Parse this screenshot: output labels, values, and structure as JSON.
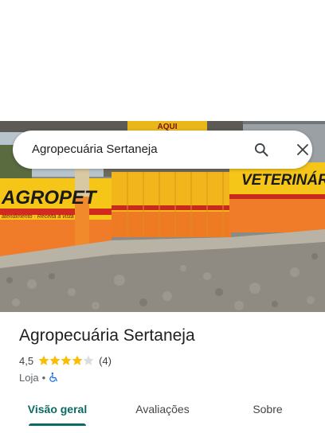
{
  "search": {
    "query": "Agropecuária Sertaneja"
  },
  "photo": {
    "signs": {
      "top": "AQUI",
      "left": "AGROPET",
      "left_sub": "atendimento · Receita à vista",
      "right": "VETERINÁRIA"
    }
  },
  "place": {
    "name": "Agropecuária Sertaneja",
    "rating": "4,5",
    "rating_fraction": 0.9,
    "review_count": "(4)",
    "category": "Loja",
    "separator": "•"
  },
  "tabs": [
    {
      "label": "Visão geral",
      "active": true
    },
    {
      "label": "Avaliações",
      "active": false
    },
    {
      "label": "Sobre",
      "active": false
    }
  ],
  "colors": {
    "accent": "#0b6b63",
    "star": "#fbbc04",
    "wall_yellow": "#f5c518",
    "wall_orange": "#f07c2a"
  },
  "icons": {
    "search": "search-icon",
    "close": "close-icon",
    "accessibility": "wheelchair-icon",
    "star": "star-icon"
  }
}
